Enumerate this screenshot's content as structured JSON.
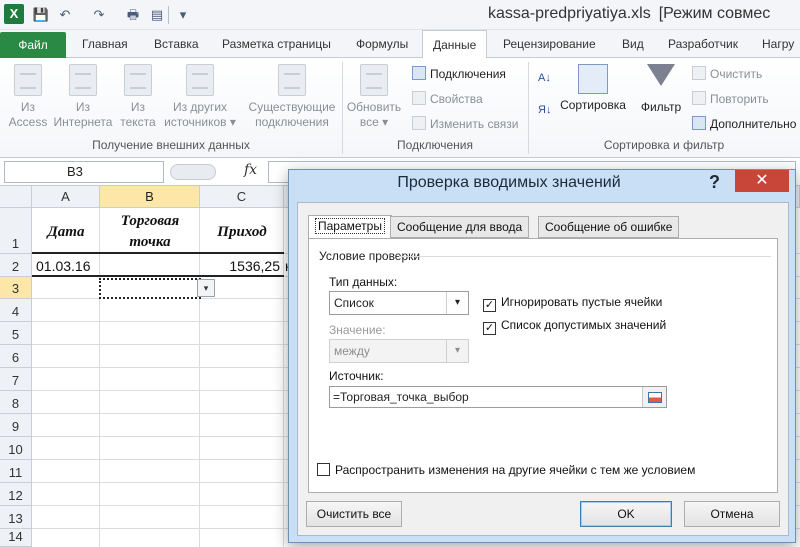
{
  "window": {
    "title_file": "kassa-predpriyatiya.xls",
    "title_mode": "[Режим совмес"
  },
  "quick_access": {
    "save": "💾",
    "undo": "↶",
    "redo": "↷",
    "print": "🖶",
    "preview": "▤",
    "more": "▾"
  },
  "tabs": [
    "Файл",
    "Главная",
    "Вставка",
    "Разметка страницы",
    "Формулы",
    "Данные",
    "Рецензирование",
    "Вид",
    "Разработчик",
    "Нагру"
  ],
  "ribbon": {
    "get_external": {
      "label": "Получение внешних данных",
      "buttons": [
        {
          "line1": "Из",
          "line2": "Access"
        },
        {
          "line1": "Из",
          "line2": "Интернета"
        },
        {
          "line1": "Из",
          "line2": "текста"
        },
        {
          "line1": "Из других",
          "line2": "источников ▾"
        },
        {
          "line1": "Существующие",
          "line2": "подключения"
        }
      ]
    },
    "connections": {
      "label": "Подключения",
      "refresh": {
        "line1": "Обновить",
        "line2": "все ▾"
      },
      "items": [
        "Подключения",
        "Свойства",
        "Изменить связи"
      ]
    },
    "sort_filter": {
      "label": "Сортировка и фильтр",
      "az": "А↓",
      "za": "Я↓",
      "sort": "Сортировка",
      "filter": "Фильтр",
      "items": [
        "Очистить",
        "Повторить",
        "Дополнительно"
      ]
    }
  },
  "formula_bar": {
    "name_box": "B3",
    "fx": "fx"
  },
  "sheet": {
    "columns": [
      "A",
      "B",
      "C"
    ],
    "rows": [
      "1",
      "2",
      "3",
      "4",
      "5",
      "6",
      "7",
      "8",
      "9",
      "10",
      "11",
      "12",
      "13",
      "14"
    ],
    "header_cells": {
      "a1": "Дата",
      "b1_line1": "Торговая",
      "b1_line2": "точка",
      "c1": "Приход"
    },
    "row2": {
      "a": "01.03.16",
      "b": "",
      "c": "1536,25",
      "d_clip": "н"
    },
    "dropdown_arrow": "▾"
  },
  "dialog": {
    "title": "Проверка вводимых значений",
    "help": "?",
    "close": "✕",
    "tabs": [
      "Параметры",
      "Сообщение для ввода",
      "Сообщение об ошибке"
    ],
    "section_label": "Условие проверки",
    "data_type_label": "Тип данных:",
    "data_type_value": "Список",
    "value_label": "Значение:",
    "value_value": "между",
    "ignore_blank": {
      "label": "Игнорировать пустые ячейки",
      "checked": true
    },
    "in_cell_dropdown": {
      "label": "Список допустимых значений",
      "checked": true
    },
    "source_label": "Источник:",
    "source_value": "=Торговая_точка_выбор",
    "apply_all": {
      "label": "Распространить изменения на другие ячейки с тем же условием",
      "checked": false
    },
    "buttons": {
      "clear": "Очистить все",
      "ok": "OK",
      "cancel": "Отмена"
    },
    "check_mark": "✓",
    "arrow": "▾"
  }
}
